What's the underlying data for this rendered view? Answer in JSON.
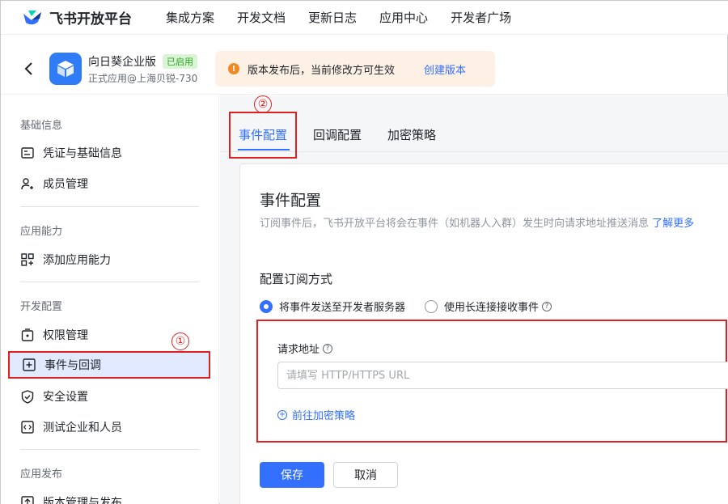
{
  "topbar": {
    "logo_text": "飞书开放平台",
    "nav": [
      "集成方案",
      "开发文档",
      "更新日志",
      "应用中心",
      "开发者广场"
    ]
  },
  "appbar": {
    "app_name": "向日葵企业版",
    "badge": "已启用",
    "app_sub": "正式应用@上海贝锐-730",
    "notice_text": "版本发布后，当前修改方可生效",
    "notice_link": "创建版本"
  },
  "sidebar": {
    "sections": [
      "基础信息",
      "应用能力",
      "开发配置",
      "应用发布"
    ],
    "items": [
      {
        "label": "凭证与基础信息",
        "icon": "id-card-icon"
      },
      {
        "label": "成员管理",
        "icon": "user-add-icon"
      },
      {
        "label": "添加应用能力",
        "icon": "grid-add-icon"
      },
      {
        "label": "权限管理",
        "icon": "lock-icon"
      },
      {
        "label": "事件与回调",
        "icon": "event-icon"
      },
      {
        "label": "安全设置",
        "icon": "shield-icon"
      },
      {
        "label": "测试企业和人员",
        "icon": "code-icon"
      },
      {
        "label": "版本管理与发布",
        "icon": "upload-icon"
      }
    ],
    "annotation_1": "①"
  },
  "main": {
    "tabs": [
      "事件配置",
      "回调配置",
      "加密策略"
    ],
    "annotation_2": "②",
    "card_title": "事件配置",
    "card_desc": "订阅事件后，飞书开放平台将会在事件（如机器人入群）发生时向请求地址推送消息",
    "card_desc_link": "了解更多",
    "sub_title": "配置订阅方式",
    "radio_1": "将事件发送至开发者服务器",
    "radio_2": "使用长连接接收事件",
    "req_label": "请求地址",
    "req_placeholder": "请填写 HTTP/HTTPS URL",
    "req_link": "前往加密策略",
    "save": "保存",
    "cancel": "取消"
  },
  "colors": {
    "accent": "#3370ff",
    "annotation": "#e02020",
    "badge_bg": "#d9f5d6",
    "notice_bg": "#fdf1e6"
  }
}
